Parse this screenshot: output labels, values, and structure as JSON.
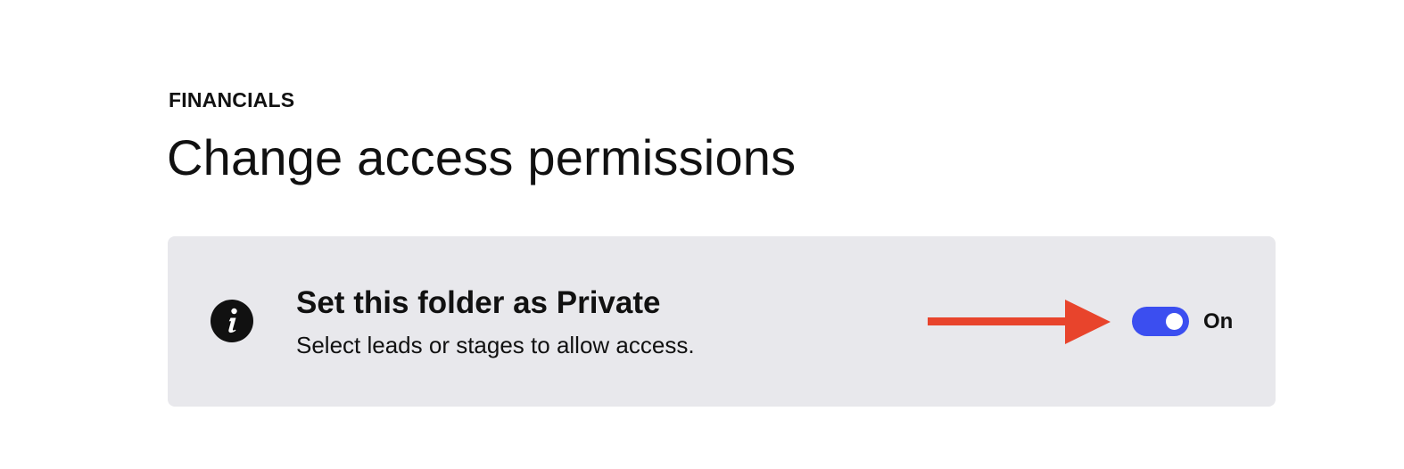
{
  "header": {
    "eyebrow": "FINANCIALS",
    "title": "Change access permissions"
  },
  "privacy_panel": {
    "icon": "info-icon",
    "heading": "Set this folder as Private",
    "description": "Select leads or stages to allow access.",
    "toggle": {
      "state": "on",
      "state_label": "On",
      "active_color": "#3b4ef0"
    },
    "annotation": {
      "icon": "red-arrow-icon",
      "color": "#e8442c"
    }
  },
  "colors": {
    "panel_background": "#e8e8ec",
    "text": "#111111",
    "page_background": "#ffffff"
  }
}
